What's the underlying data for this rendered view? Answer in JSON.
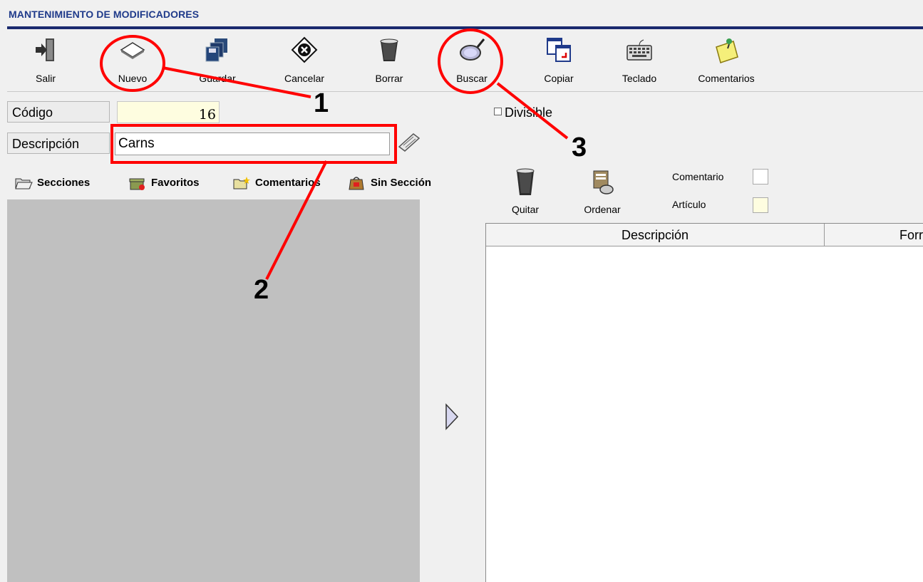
{
  "window": {
    "title": "MANTENIMIENTO DE MODIFICADORES"
  },
  "toolbar": {
    "items": [
      {
        "label": "Salir",
        "icon": "exit-door-icon"
      },
      {
        "label": "Nuevo",
        "icon": "new-sheet-icon"
      },
      {
        "label": "Guardar",
        "icon": "save-disks-icon"
      },
      {
        "label": "Cancelar",
        "icon": "cancel-x-icon"
      },
      {
        "label": "Borrar",
        "icon": "trash-can-icon"
      },
      {
        "label": "Buscar",
        "icon": "magnifier-icon"
      },
      {
        "label": "Copiar",
        "icon": "copy-windows-icon"
      },
      {
        "label": "Teclado",
        "icon": "keyboard-icon"
      },
      {
        "label": "Comentarios",
        "icon": "sticky-note-icon"
      }
    ]
  },
  "form": {
    "codigo_label": "Código",
    "codigo_value": "16",
    "descripcion_label": "Descripción",
    "descripcion_value": "Carns",
    "divisible_label": "Divisible",
    "divisible_checked": false
  },
  "tabs": [
    {
      "label": "Secciones",
      "icon": "folder-open-icon"
    },
    {
      "label": "Favoritos",
      "icon": "gift-box-icon"
    },
    {
      "label": "Comentarios",
      "icon": "folder-star-icon"
    },
    {
      "label": "Sin Sección",
      "icon": "bag-icon"
    }
  ],
  "right_toolbar": {
    "quitar_label": "Quitar",
    "ordenar_label": "Ordenar",
    "legend": [
      {
        "label": "Comentario",
        "color": "#ffffff"
      },
      {
        "label": "Artículo",
        "color": "#fefde0"
      }
    ]
  },
  "grid": {
    "columns": [
      "Descripción",
      "Forr"
    ]
  },
  "annotations": [
    "1",
    "2",
    "3"
  ],
  "colors": {
    "accent": "#1f3a8a",
    "annotation": "#ff0000",
    "panel": "#c0c0c0"
  }
}
